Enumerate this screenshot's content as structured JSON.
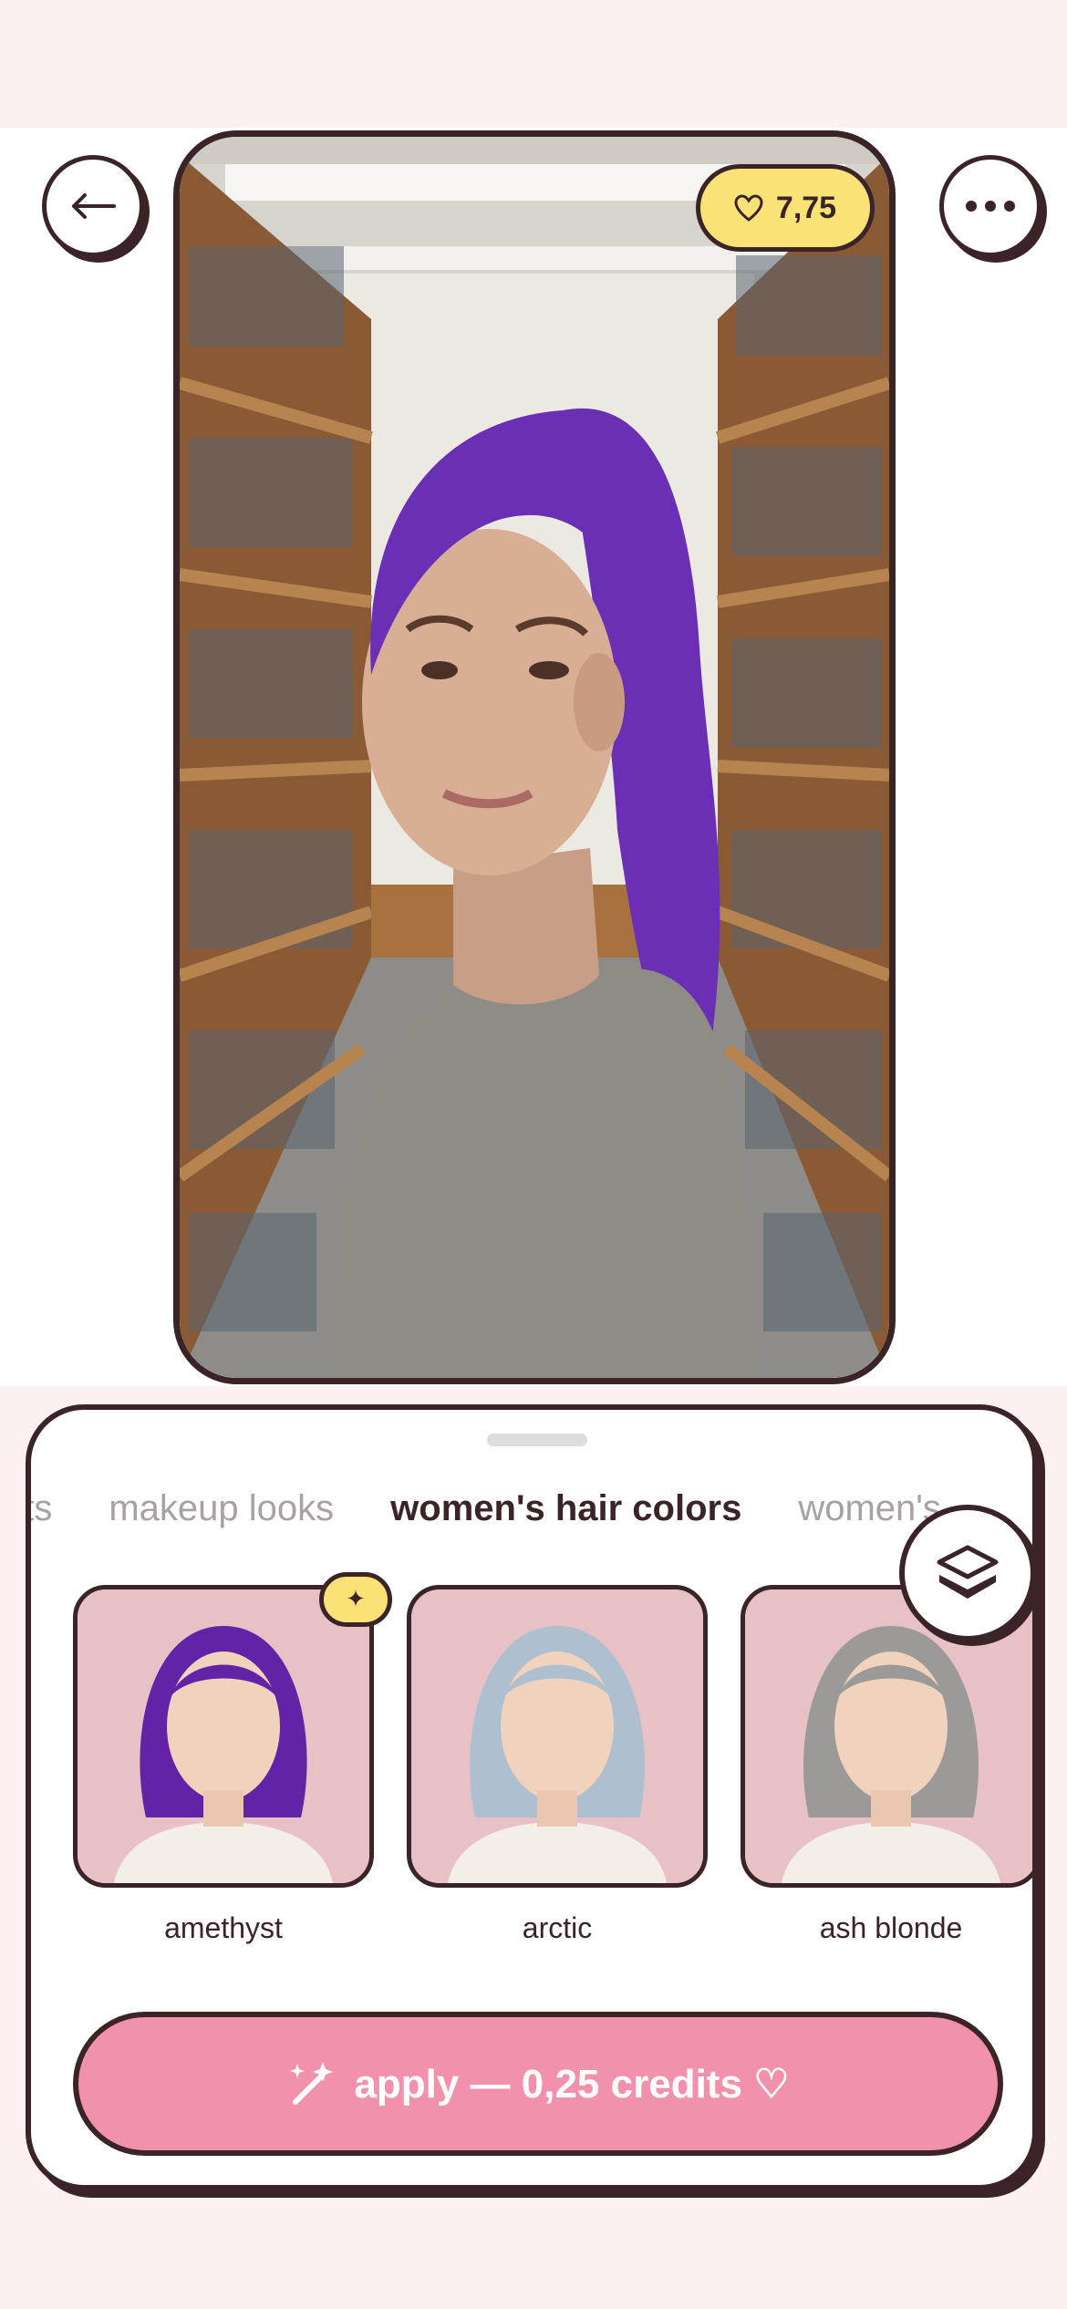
{
  "header": {
    "back_icon": "arrow-left-icon",
    "more_icon": "more-dots-icon",
    "credits_icon": "heart-outline-icon",
    "credits_balance": "7,75"
  },
  "preview": {
    "hair_color": "#6a2fb4",
    "accent": "#fbe277"
  },
  "sheet": {
    "tabs": [
      {
        "label": "uts",
        "active": false
      },
      {
        "label": "makeup looks",
        "active": false
      },
      {
        "label": "women's hair colors",
        "active": true
      },
      {
        "label": "women's",
        "active": false
      }
    ],
    "layers_icon": "layers-icon",
    "styles": [
      {
        "label": "amethyst",
        "hair": "#6223a6",
        "selected": true,
        "badge_icon": "sparkle-icon"
      },
      {
        "label": "arctic",
        "hair": "#aebfd0",
        "selected": false
      },
      {
        "label": "ash blonde",
        "hair": "#9b9a98",
        "selected": false
      }
    ],
    "apply_button": {
      "icon": "magic-wand-icon",
      "label": "apply — 0,25 credits ♡"
    }
  },
  "colors": {
    "background": "#fdf0f3",
    "outline": "#3a2428",
    "pink_accent": "#f291ac",
    "yellow_accent": "#fbe277"
  }
}
